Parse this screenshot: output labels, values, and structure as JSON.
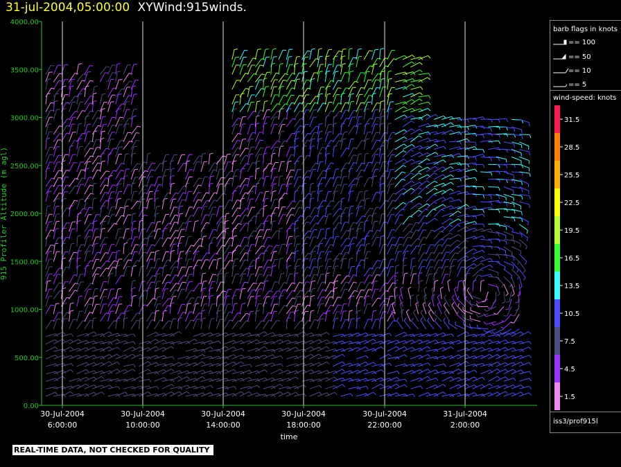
{
  "title": {
    "date": "31-jul-2004,05:00:00",
    "name": "XYWind:915winds."
  },
  "chart_data": {
    "type": "scatter",
    "subtype": "wind-barb time-height plot",
    "title": "31-jul-2004,05:00:00  XYWind:915winds.",
    "xlabel": "time",
    "ylabel": "915 Profiler Altitude (m agl)",
    "ylim": [
      0,
      4000
    ],
    "y_ticks": [
      "0.00",
      "500.00",
      "1000.00",
      "1500.00",
      "2000.00",
      "2500.00",
      "3000.00",
      "3500.00",
      "4000.00"
    ],
    "x_ticks": [
      {
        "date": "30-Jul-2004",
        "time": "6:00:00"
      },
      {
        "date": "30-Jul-2004",
        "time": "10:00:00"
      },
      {
        "date": "30-Jul-2004",
        "time": "14:00:00"
      },
      {
        "date": "30-Jul-2004",
        "time": "18:00:00"
      },
      {
        "date": "30-Jul-2004",
        "time": "22:00:00"
      },
      {
        "date": "31-Jul-2004",
        "time": "2:00:00"
      }
    ],
    "grid": "vertical lines at x ticks",
    "source_label": "iss3/prof915l"
  },
  "legend": {
    "flags_title": "barb flags in knots",
    "flags": [
      "== 100",
      "== 50",
      "== 10",
      "== 5"
    ],
    "speed_title": "wind-speed: knots",
    "speed_bins": [
      {
        "label": "31.5",
        "color": "#ff1a4d"
      },
      {
        "label": "28.5",
        "color": "#ff8000"
      },
      {
        "label": "25.5",
        "color": "#ffb300"
      },
      {
        "label": "22.5",
        "color": "#ffff00"
      },
      {
        "label": "19.5",
        "color": "#b3ff33"
      },
      {
        "label": "16.5",
        "color": "#33ff33"
      },
      {
        "label": "13.5",
        "color": "#33ffff"
      },
      {
        "label": "10.5",
        "color": "#4d4dff"
      },
      {
        "label": "7.5",
        "color": "#4d4d80"
      },
      {
        "label": "4.5",
        "color": "#9933ff"
      },
      {
        "label": "1.5",
        "color": "#ee88ee"
      }
    ]
  },
  "footer": "REAL-TIME DATA, NOT CHECKED FOR QUALITY"
}
